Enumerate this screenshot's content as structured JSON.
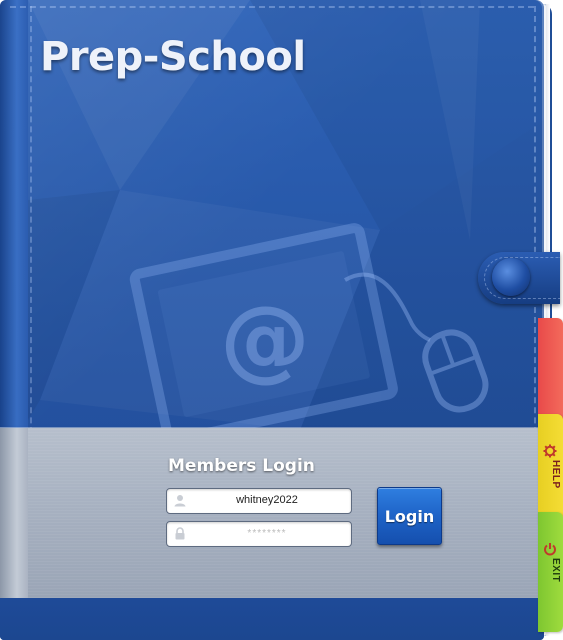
{
  "app": {
    "title": "Prep-School",
    "accent_color": "#2656a6",
    "band_color": "#a6b0c0"
  },
  "cover_art": {
    "icon": "email-at-icon",
    "mouse_icon": "mouse-icon",
    "at_symbol": "@"
  },
  "tabs": [
    {
      "name": "red-tab",
      "label": "",
      "color": "#f05a52",
      "icon": ""
    },
    {
      "name": "help-tab",
      "label": "HELP",
      "color": "#f0d82c",
      "icon": "gear-icon"
    },
    {
      "name": "exit-tab",
      "label": "EXIT",
      "color": "#8fd237",
      "icon": "power-icon"
    }
  ],
  "login": {
    "heading": "Members Login",
    "username": {
      "value": "whitney2022",
      "icon": "user-icon"
    },
    "password": {
      "value": "********",
      "icon": "lock-icon"
    },
    "button_label": "Login"
  }
}
